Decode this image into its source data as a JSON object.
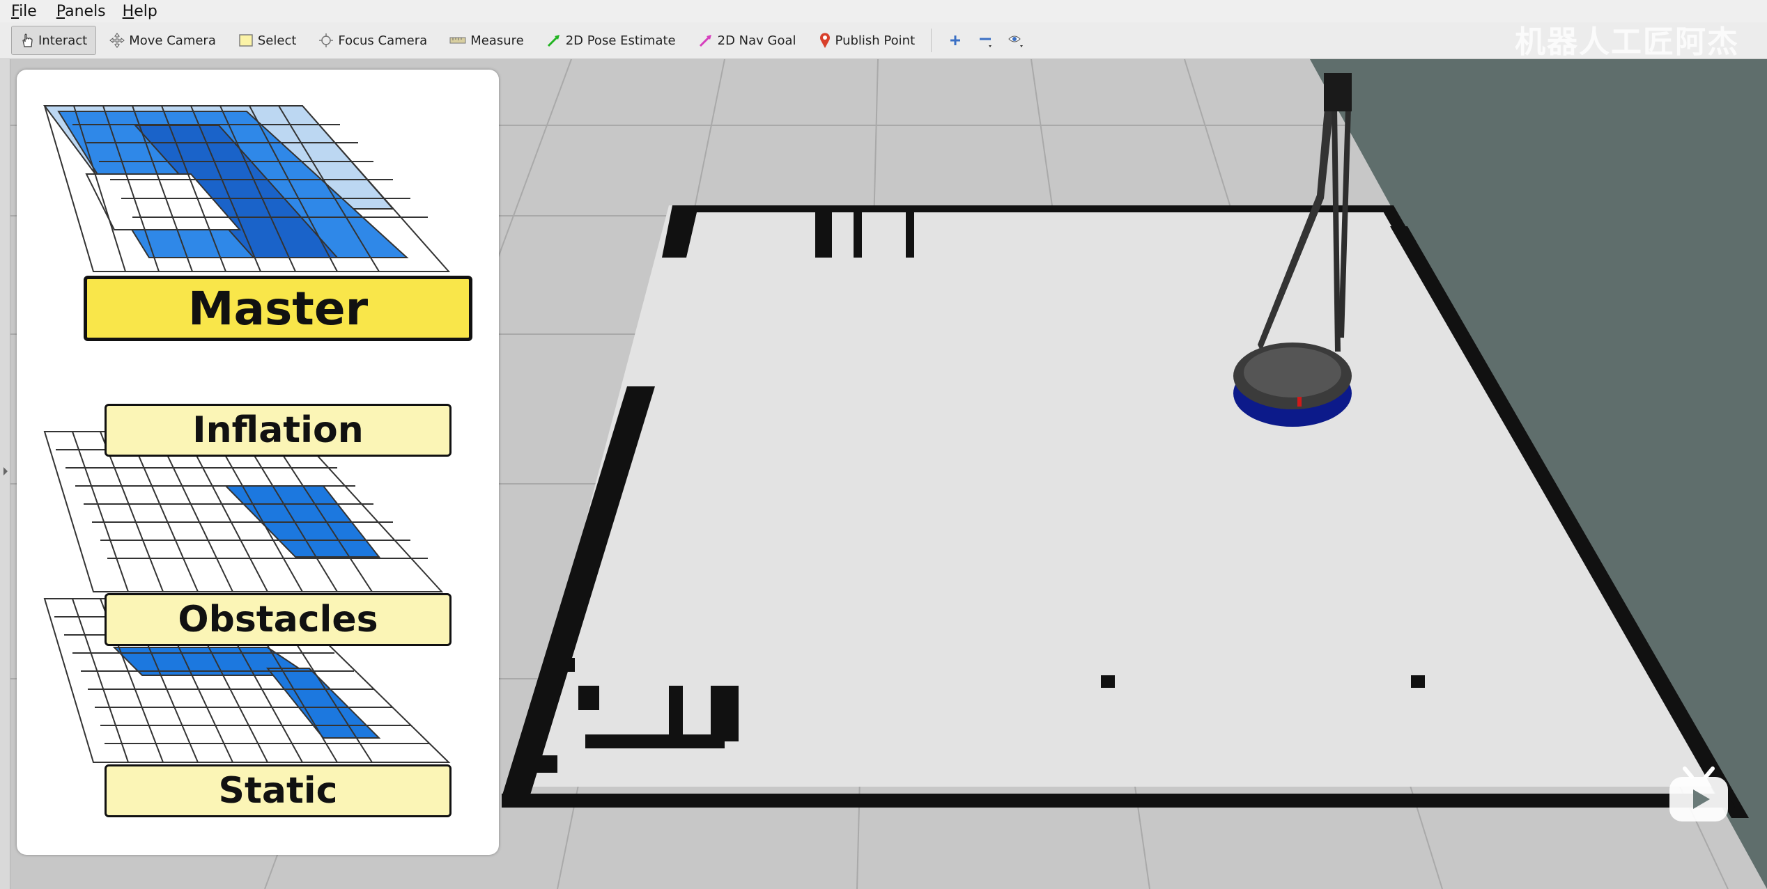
{
  "menubar": {
    "items": [
      {
        "label": "File"
      },
      {
        "label": "Panels"
      },
      {
        "label": "Help"
      }
    ]
  },
  "toolbar": {
    "tools": [
      {
        "label": "Interact",
        "icon": "hand-pointer-icon",
        "active": true
      },
      {
        "label": "Move Camera",
        "icon": "move-camera-icon"
      },
      {
        "label": "Select",
        "icon": "select-box-icon"
      },
      {
        "label": "Focus Camera",
        "icon": "focus-camera-icon"
      },
      {
        "label": "Measure",
        "icon": "ruler-icon"
      },
      {
        "label": "2D Pose Estimate",
        "icon": "green-arrow-icon"
      },
      {
        "label": "2D Nav Goal",
        "icon": "pink-arrow-icon"
      },
      {
        "label": "Publish Point",
        "icon": "map-pin-icon"
      }
    ],
    "extra_icons": [
      "plus-icon",
      "minus-icon",
      "eye-icon"
    ]
  },
  "watermark": "机器人工匠阿杰",
  "costmap_layers": {
    "master": "Master",
    "inflation": "Inflation",
    "obstacles": "Obstacles",
    "static": "Static"
  },
  "colors": {
    "grid_floor": "#c7c7c7",
    "background": "#5f6e6c",
    "obstacle_black": "#111111",
    "layer_blue": "#1e7be0",
    "label_yellow": "#fbf5b6",
    "master_yellow": "#f9e64a",
    "robot_base_blue": "#0c1a8a"
  }
}
